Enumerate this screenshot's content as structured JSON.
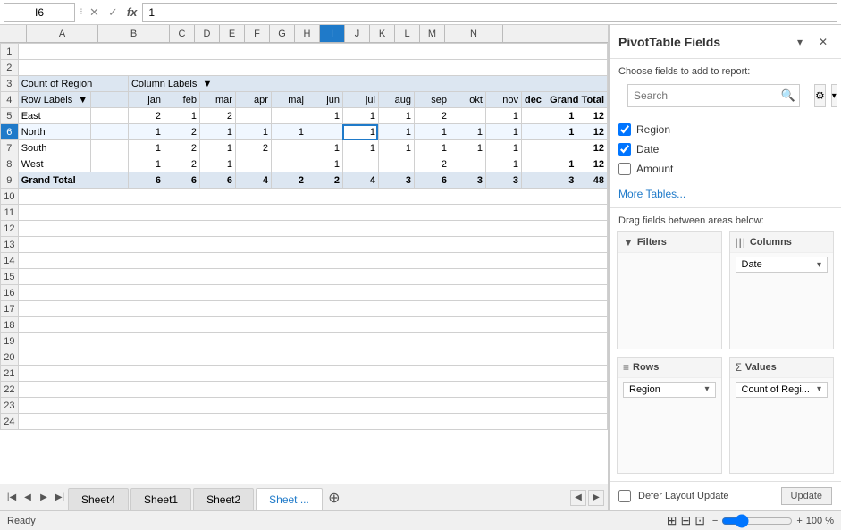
{
  "formulaBar": {
    "cellRef": "I6",
    "value": "1",
    "closeLabel": "✕",
    "confirmLabel": "✓",
    "fxLabel": "fx"
  },
  "columns": [
    "A",
    "B",
    "C",
    "D",
    "E",
    "F",
    "G",
    "H",
    "I",
    "J",
    "K",
    "L",
    "M",
    "N"
  ],
  "rows": [
    {
      "num": 1,
      "cells": []
    },
    {
      "num": 2,
      "cells": []
    },
    {
      "num": 3,
      "cells": [
        {
          "col": "A",
          "val": "Count of Region",
          "colspan": 2
        },
        {
          "col": "B",
          "val": ""
        },
        {
          "col": "C",
          "val": "Column Labels"
        },
        {
          "col": "D",
          "val": "▼"
        }
      ]
    },
    {
      "num": 4,
      "cells": [
        {
          "col": "A",
          "val": "Row Labels"
        },
        {
          "col": "B",
          "val": "▼"
        },
        {
          "col": "C",
          "val": "jan"
        },
        {
          "col": "D",
          "val": "feb"
        },
        {
          "col": "E",
          "val": "mar"
        },
        {
          "col": "F",
          "val": "apr"
        },
        {
          "col": "G",
          "val": "maj"
        },
        {
          "col": "H",
          "val": "jun"
        },
        {
          "col": "I",
          "val": "jul"
        },
        {
          "col": "J",
          "val": "aug"
        },
        {
          "col": "K",
          "val": "sep"
        },
        {
          "col": "L",
          "val": "okt"
        },
        {
          "col": "M",
          "val": "nov"
        },
        {
          "col": "N2",
          "val": "dec"
        },
        {
          "col": "N",
          "val": "Grand Total"
        }
      ]
    },
    {
      "num": 5,
      "cells": [
        {
          "col": "A",
          "val": "East"
        },
        {
          "col": "C",
          "val": "2"
        },
        {
          "col": "D",
          "val": "1"
        },
        {
          "col": "E",
          "val": "2"
        },
        {
          "col": "H",
          "val": "1"
        },
        {
          "col": "I",
          "val": "1"
        },
        {
          "col": "J",
          "val": "1"
        },
        {
          "col": "K",
          "val": "2"
        },
        {
          "col": "L",
          "val": ""
        },
        {
          "col": "M",
          "val": "1"
        },
        {
          "col": "Nn",
          "val": "1"
        },
        {
          "col": "N",
          "val": "12"
        }
      ]
    },
    {
      "num": 6,
      "cells": [
        {
          "col": "A",
          "val": "North"
        },
        {
          "col": "C",
          "val": "1"
        },
        {
          "col": "D",
          "val": "2"
        },
        {
          "col": "E",
          "val": "1"
        },
        {
          "col": "F",
          "val": "1"
        },
        {
          "col": "G",
          "val": "1"
        },
        {
          "col": "I",
          "val": "1"
        },
        {
          "col": "Ii",
          "val": "1"
        },
        {
          "col": "J",
          "val": "1"
        },
        {
          "col": "K",
          "val": "1"
        },
        {
          "col": "L",
          "val": "1"
        },
        {
          "col": "M",
          "val": "1"
        },
        {
          "col": "N",
          "val": "12"
        }
      ]
    },
    {
      "num": 7,
      "cells": [
        {
          "col": "A",
          "val": "South"
        },
        {
          "col": "C",
          "val": "1"
        },
        {
          "col": "D",
          "val": "2"
        },
        {
          "col": "E",
          "val": "1"
        },
        {
          "col": "F",
          "val": "2"
        },
        {
          "col": "H",
          "val": "1"
        },
        {
          "col": "I",
          "val": "1"
        },
        {
          "col": "J",
          "val": "1"
        },
        {
          "col": "K",
          "val": "1"
        },
        {
          "col": "L",
          "val": "1"
        },
        {
          "col": "M",
          "val": "1"
        },
        {
          "col": "N",
          "val": "12"
        }
      ]
    },
    {
      "num": 8,
      "cells": [
        {
          "col": "A",
          "val": "West"
        },
        {
          "col": "C",
          "val": "1"
        },
        {
          "col": "D",
          "val": "2"
        },
        {
          "col": "E",
          "val": "1"
        },
        {
          "col": "H",
          "val": "1"
        },
        {
          "col": "K",
          "val": "2"
        },
        {
          "col": "M",
          "val": "1"
        },
        {
          "col": "N",
          "val": "12"
        }
      ]
    },
    {
      "num": 9,
      "cells": [
        {
          "col": "A",
          "val": "Grand Total"
        },
        {
          "col": "C",
          "val": "6"
        },
        {
          "col": "D",
          "val": "6"
        },
        {
          "col": "E",
          "val": "6"
        },
        {
          "col": "F",
          "val": "4"
        },
        {
          "col": "G",
          "val": "2"
        },
        {
          "col": "H",
          "val": "2"
        },
        {
          "col": "I",
          "val": "4"
        },
        {
          "col": "J",
          "val": "3"
        },
        {
          "col": "K",
          "val": "6"
        },
        {
          "col": "L",
          "val": "3"
        },
        {
          "col": "M",
          "val": "3"
        },
        {
          "col": "N2",
          "val": "3"
        },
        {
          "col": "N",
          "val": "48"
        }
      ]
    },
    {
      "num": 10,
      "cells": []
    },
    {
      "num": 11,
      "cells": []
    },
    {
      "num": 12,
      "cells": []
    },
    {
      "num": 13,
      "cells": []
    },
    {
      "num": 14,
      "cells": []
    },
    {
      "num": 15,
      "cells": []
    },
    {
      "num": 16,
      "cells": []
    },
    {
      "num": 17,
      "cells": []
    },
    {
      "num": 18,
      "cells": []
    },
    {
      "num": 19,
      "cells": []
    },
    {
      "num": 20,
      "cells": []
    },
    {
      "num": 21,
      "cells": []
    },
    {
      "num": 22,
      "cells": []
    },
    {
      "num": 23,
      "cells": []
    },
    {
      "num": 24,
      "cells": []
    }
  ],
  "sheetTabs": [
    "Sheet4",
    "Sheet1",
    "Sheet2",
    "Sheet..."
  ],
  "activeTab": "Sheet...",
  "statusBar": {
    "ready": "Ready",
    "zoomPercent": "100 %"
  },
  "pivotPanel": {
    "title": "PivotTable Fields",
    "chooseText": "Choose fields to add to report:",
    "searchPlaceholder": "Search",
    "fields": [
      {
        "label": "Region",
        "checked": true
      },
      {
        "label": "Date",
        "checked": true
      },
      {
        "label": "Amount",
        "checked": false
      }
    ],
    "moreTablesLabel": "More Tables...",
    "dragLabel": "Drag fields between areas below:",
    "areas": [
      {
        "icon": "▼",
        "label": "Filters",
        "chips": []
      },
      {
        "icon": "|||",
        "label": "Columns",
        "chips": [
          {
            "label": "Date"
          }
        ]
      },
      {
        "icon": "≡",
        "label": "Rows",
        "chips": [
          {
            "label": "Region"
          }
        ]
      },
      {
        "icon": "Σ",
        "label": "Values",
        "chips": [
          {
            "label": "Count of Regi..."
          }
        ]
      }
    ],
    "deferLabel": "Defer Layout Update",
    "updateLabel": "Update"
  }
}
